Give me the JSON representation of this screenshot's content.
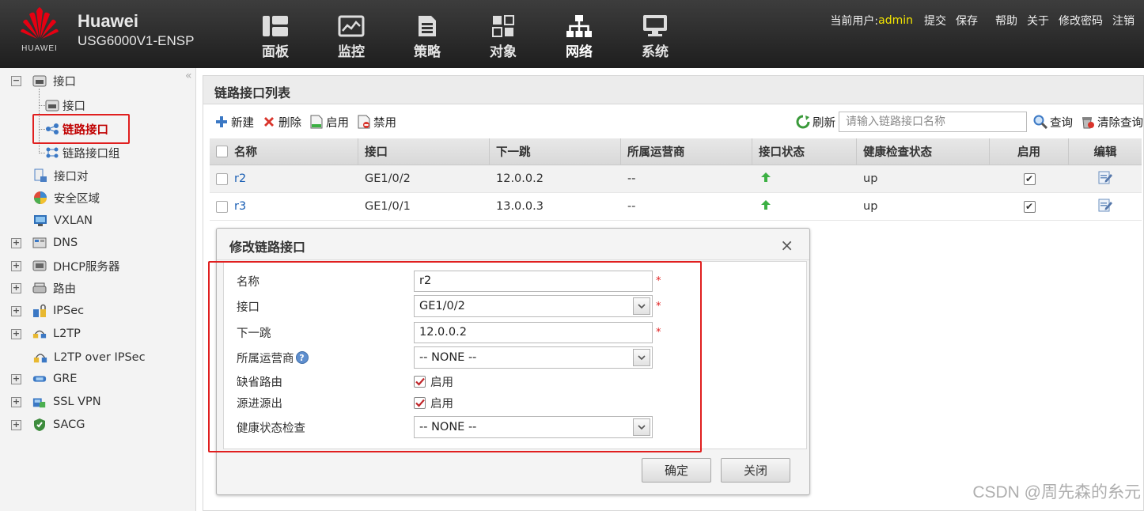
{
  "header": {
    "brand_name": "Huawei",
    "device_model": "USG6000V1-ENSP",
    "logo_text": "HUAWEI",
    "nav": [
      {
        "label": "面板",
        "icon": "dashboard-icon"
      },
      {
        "label": "监控",
        "icon": "monitor-icon"
      },
      {
        "label": "策略",
        "icon": "policy-icon"
      },
      {
        "label": "对象",
        "icon": "object-icon"
      },
      {
        "label": "网络",
        "icon": "network-icon",
        "active": true
      },
      {
        "label": "系统",
        "icon": "system-icon"
      }
    ],
    "current_user_label": "当前用户:",
    "current_user": "admin",
    "links": [
      "提交",
      "保存",
      "帮助",
      "关于",
      "修改密码",
      "注销"
    ]
  },
  "sidebar": {
    "collapse_glyph": "«",
    "items": [
      {
        "label": "接口",
        "level": 0,
        "expander": "-",
        "icon": "interface-icon"
      },
      {
        "label": "接口",
        "level": 1,
        "icon": "interface-icon"
      },
      {
        "label": "链路接口",
        "level": 1,
        "icon": "link-interface-icon",
        "selected": true
      },
      {
        "label": "链路接口组",
        "level": 1,
        "icon": "link-group-icon"
      },
      {
        "label": "接口对",
        "level": 0,
        "icon": "interface-pair-icon"
      },
      {
        "label": "安全区域",
        "level": 0,
        "icon": "security-zone-icon"
      },
      {
        "label": "VXLAN",
        "level": 0,
        "icon": "vxlan-icon"
      },
      {
        "label": "DNS",
        "level": 0,
        "expander": "+",
        "icon": "dns-icon"
      },
      {
        "label": "DHCP服务器",
        "level": 0,
        "expander": "+",
        "icon": "dhcp-icon"
      },
      {
        "label": "路由",
        "level": 0,
        "expander": "+",
        "icon": "router-icon"
      },
      {
        "label": "IPSec",
        "level": 0,
        "expander": "+",
        "icon": "ipsec-icon"
      },
      {
        "label": "L2TP",
        "level": 0,
        "expander": "+",
        "icon": "l2tp-icon"
      },
      {
        "label": "L2TP over IPSec",
        "level": 0,
        "icon": "l2tp-ipsec-icon"
      },
      {
        "label": "GRE",
        "level": 0,
        "expander": "+",
        "icon": "gre-icon"
      },
      {
        "label": "SSL VPN",
        "level": 0,
        "expander": "+",
        "icon": "ssl-vpn-icon"
      },
      {
        "label": "SACG",
        "level": 0,
        "expander": "+",
        "icon": "sacg-icon"
      }
    ]
  },
  "main": {
    "title": "链路接口列表",
    "toolbar": {
      "new": "新建",
      "delete": "删除",
      "enable": "启用",
      "disable": "禁用",
      "refresh": "刷新",
      "search_placeholder": "请输入链路接口名称",
      "query": "查询",
      "clear_query": "清除查询"
    },
    "table": {
      "columns": [
        "名称",
        "接口",
        "下一跳",
        "所属运营商",
        "接口状态",
        "健康检查状态",
        "启用",
        "编辑"
      ],
      "rows": [
        {
          "name": "r2",
          "interface": "GE1/0/2",
          "next_hop": "12.0.0.2",
          "isp": "--",
          "status": "up-arrow",
          "health": "up",
          "enabled": true
        },
        {
          "name": "r3",
          "interface": "GE1/0/1",
          "next_hop": "13.0.0.3",
          "isp": "--",
          "status": "up-arrow",
          "health": "up",
          "enabled": true
        }
      ]
    }
  },
  "dialog": {
    "title": "修改链路接口",
    "close_glyph": "×",
    "fields": {
      "name_label": "名称",
      "name_value": "r2",
      "interface_label": "接口",
      "interface_value": "GE1/0/2",
      "next_hop_label": "下一跳",
      "next_hop_value": "12.0.0.2",
      "isp_label": "所属运营商",
      "isp_value": "-- NONE --",
      "default_route_label": "缺省路由",
      "default_route_option": "启用",
      "default_route_checked": true,
      "src_in_src_out_label": "源进源出",
      "src_in_src_out_option": "启用",
      "src_in_src_out_checked": true,
      "health_check_label": "健康状态检查",
      "health_check_value": "-- NONE --"
    },
    "required_mark": "*",
    "help_glyph": "?",
    "ok_label": "确定",
    "close_label": "关闭"
  },
  "watermark": "CSDN @周先森的糸元",
  "colors": {
    "header_bg": "#2a2a2a",
    "user_highlight": "#f4e600",
    "selection_red": "#e01f1f",
    "link_blue": "#1a5fb4",
    "status_green": "#3cb043"
  }
}
